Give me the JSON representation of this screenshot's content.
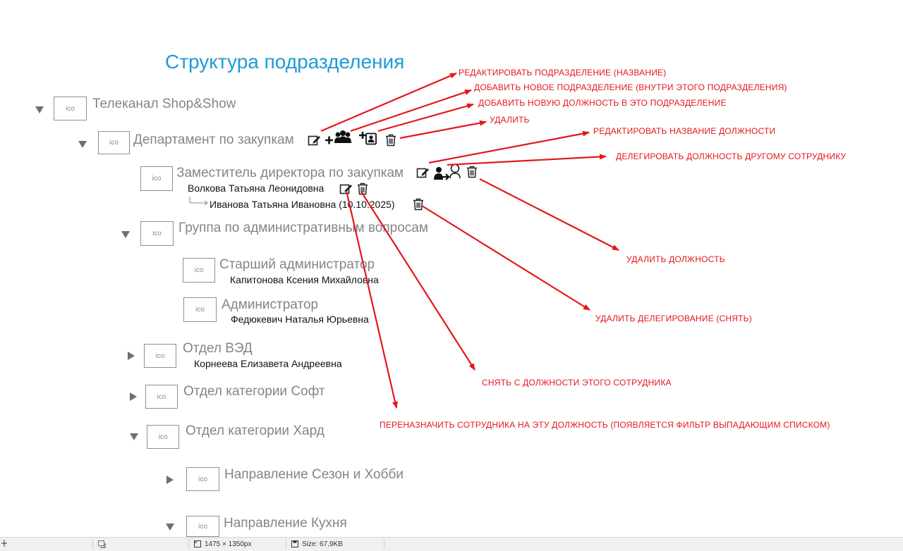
{
  "title": "Структура подразделения",
  "tree": {
    "root": {
      "label": "Телеканал Shop&Show",
      "icon": "ico"
    },
    "department": {
      "label": "Департамент по закупкам",
      "icon": "ico"
    },
    "deputy": {
      "label": "Заместитель директора по закупкам",
      "icon": "ico",
      "holder": "Волкова Татьяна Леонидовна",
      "delegate": "Иванова Татьяна Ивановна (10.10.2025)"
    },
    "group": {
      "label": "Группа по административным вопросам",
      "icon": "ico"
    },
    "senior_admin": {
      "label": "Старший администратор",
      "icon": "ico",
      "holder": "Капитонова Ксения Михайловна"
    },
    "admin": {
      "label": "Администратор",
      "icon": "ico",
      "holder": "Федюкевич Наталья Юрьевна"
    },
    "ved": {
      "label": "Отдел ВЭД",
      "icon": "ico",
      "holder": "Корнеева Елизавета Андреевна"
    },
    "soft": {
      "label": "Отдел категории Софт",
      "icon": "ico"
    },
    "hard": {
      "label": "Отдел категории Хард",
      "icon": "ico"
    },
    "season": {
      "label": "Направление Сезон и Хобби",
      "icon": "ico"
    },
    "kitchen": {
      "label": "Направление Кухня",
      "icon": "ico"
    }
  },
  "annotations": {
    "edit_dept": "РЕДАКТИРОВАТЬ ПОДРАЗДЕЛЕНИЕ (НАЗВАНИЕ)",
    "add_dept": "ДОБАВИТЬ НОВОЕ ПОДРАЗДЕЛЕНИЕ (ВНУТРИ ЭТОГО ПОДРАЗДЕЛЕНИЯ)",
    "add_position": "ДОБАВИТЬ НОВУЮ ДОЛЖНОСТЬ В ЭТО ПОДРАЗДЕЛЕНИЕ",
    "delete": "УДАЛИТЬ",
    "edit_position": "РЕДАКТИРОВАТЬ НАЗВАНИЕ ДОЛЖНОСТИ",
    "delegate_position": "ДЕЛЕГИРОВАТЬ ДОЛЖНОСТЬ ДРУГОМУ СОТРУДНИКУ",
    "delete_position": "УДАЛИТЬ ДОЛЖНОСТЬ",
    "delete_delegation": "УДАЛИТЬ ДЕЛЕГИРОВАНИЕ (СНЯТЬ)",
    "remove_employee": "СНЯТЬ С ДОЛЖНОСТИ ЭТОГО СОТРУДНИКА",
    "reassign_employee": "ПЕРЕНАЗНАЧИТЬ СОТРУДНИКА НА ЭТУ ДОЛЖНОСТЬ (ПОЯВЛЯЕТСЯ ФИЛЬТР ВЫПАДАЮЩИМ СПИСКОМ)"
  },
  "status_bar": {
    "dimensions": "1475 × 1350px",
    "size": "Size: 67,9KB"
  },
  "colors": {
    "title": "#1e9bd7",
    "annotation": "#e4161b",
    "node_text": "#858585"
  }
}
